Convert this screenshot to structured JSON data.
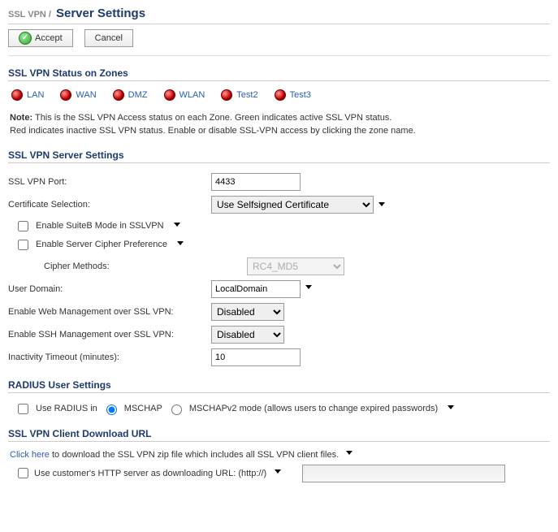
{
  "breadcrumb": "SSL VPN /",
  "title": "Server Settings",
  "buttons": {
    "accept": "Accept",
    "cancel": "Cancel"
  },
  "zones_section": {
    "title": "SSL VPN Status on Zones",
    "items": [
      {
        "label": "LAN",
        "status": "red"
      },
      {
        "label": "WAN",
        "status": "red"
      },
      {
        "label": "DMZ",
        "status": "red"
      },
      {
        "label": "WLAN",
        "status": "red"
      },
      {
        "label": "Test2",
        "status": "red"
      },
      {
        "label": "Test3",
        "status": "red"
      }
    ],
    "note_label": "Note:",
    "note_line1": "This is the SSL VPN Access status on each Zone. Green indicates active SSL VPN status.",
    "note_line2": "Red indicates inactive SSL VPN status. Enable or disable SSL-VPN access by clicking the zone name."
  },
  "server_section": {
    "title": "SSL VPN Server Settings",
    "port_label": "SSL VPN Port:",
    "port_value": "4433",
    "cert_label": "Certificate Selection:",
    "cert_value": "Use Selfsigned Certificate",
    "suiteb_label": "Enable SuiteB Mode in SSLVPN",
    "cipher_pref_label": "Enable Server Cipher Preference",
    "cipher_methods_label": "Cipher Methods:",
    "cipher_methods_value": "RC4_MD5",
    "user_domain_label": "User Domain:",
    "user_domain_value": "LocalDomain",
    "web_mgmt_label": "Enable Web Management over SSL VPN:",
    "web_mgmt_value": "Disabled",
    "ssh_mgmt_label": "Enable SSH Management over SSL VPN:",
    "ssh_mgmt_value": "Disabled",
    "timeout_label": "Inactivity Timeout (minutes):",
    "timeout_value": "10"
  },
  "radius_section": {
    "title": "RADIUS User Settings",
    "use_radius_label": "Use RADIUS in",
    "opt_mschap": "MSCHAP",
    "opt_mschapv2": "MSCHAPv2 mode (allows users to change expired passwords)"
  },
  "download_section": {
    "title": "SSL VPN Client Download URL",
    "click_here": "Click here",
    "click_rest": " to download the SSL VPN zip file which includes all SSL VPN client files.",
    "custom_url_label": "Use customer's HTTP server as downloading URL: (http://)"
  }
}
